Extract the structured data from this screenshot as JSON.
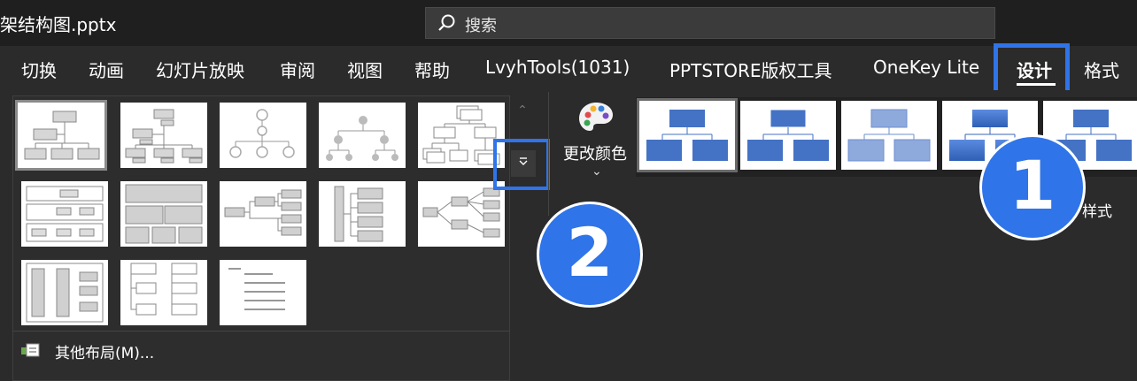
{
  "window": {
    "title": "架结构图.pptx"
  },
  "search": {
    "label": "搜索"
  },
  "tabs": [
    {
      "label": "切换"
    },
    {
      "label": "动画"
    },
    {
      "label": "幻灯片放映"
    },
    {
      "label": "审阅"
    },
    {
      "label": "视图"
    },
    {
      "label": "帮助"
    },
    {
      "label": "LvyhTools(1031)"
    },
    {
      "label": "PPTSTORE版权工具"
    },
    {
      "label": "OneKey Lite"
    },
    {
      "label": "设计"
    },
    {
      "label": "格式"
    }
  ],
  "layouts": {
    "more_label": "其他布局(M)...",
    "count": 13
  },
  "change_colors": {
    "label": "更改颜色"
  },
  "smartart_styles": {
    "label_partial": "样式"
  },
  "annotations": {
    "badge1": "1",
    "badge2": "2"
  },
  "colors": {
    "accent_highlight": "#2f74e8",
    "shape_blue": "#4472c4"
  }
}
